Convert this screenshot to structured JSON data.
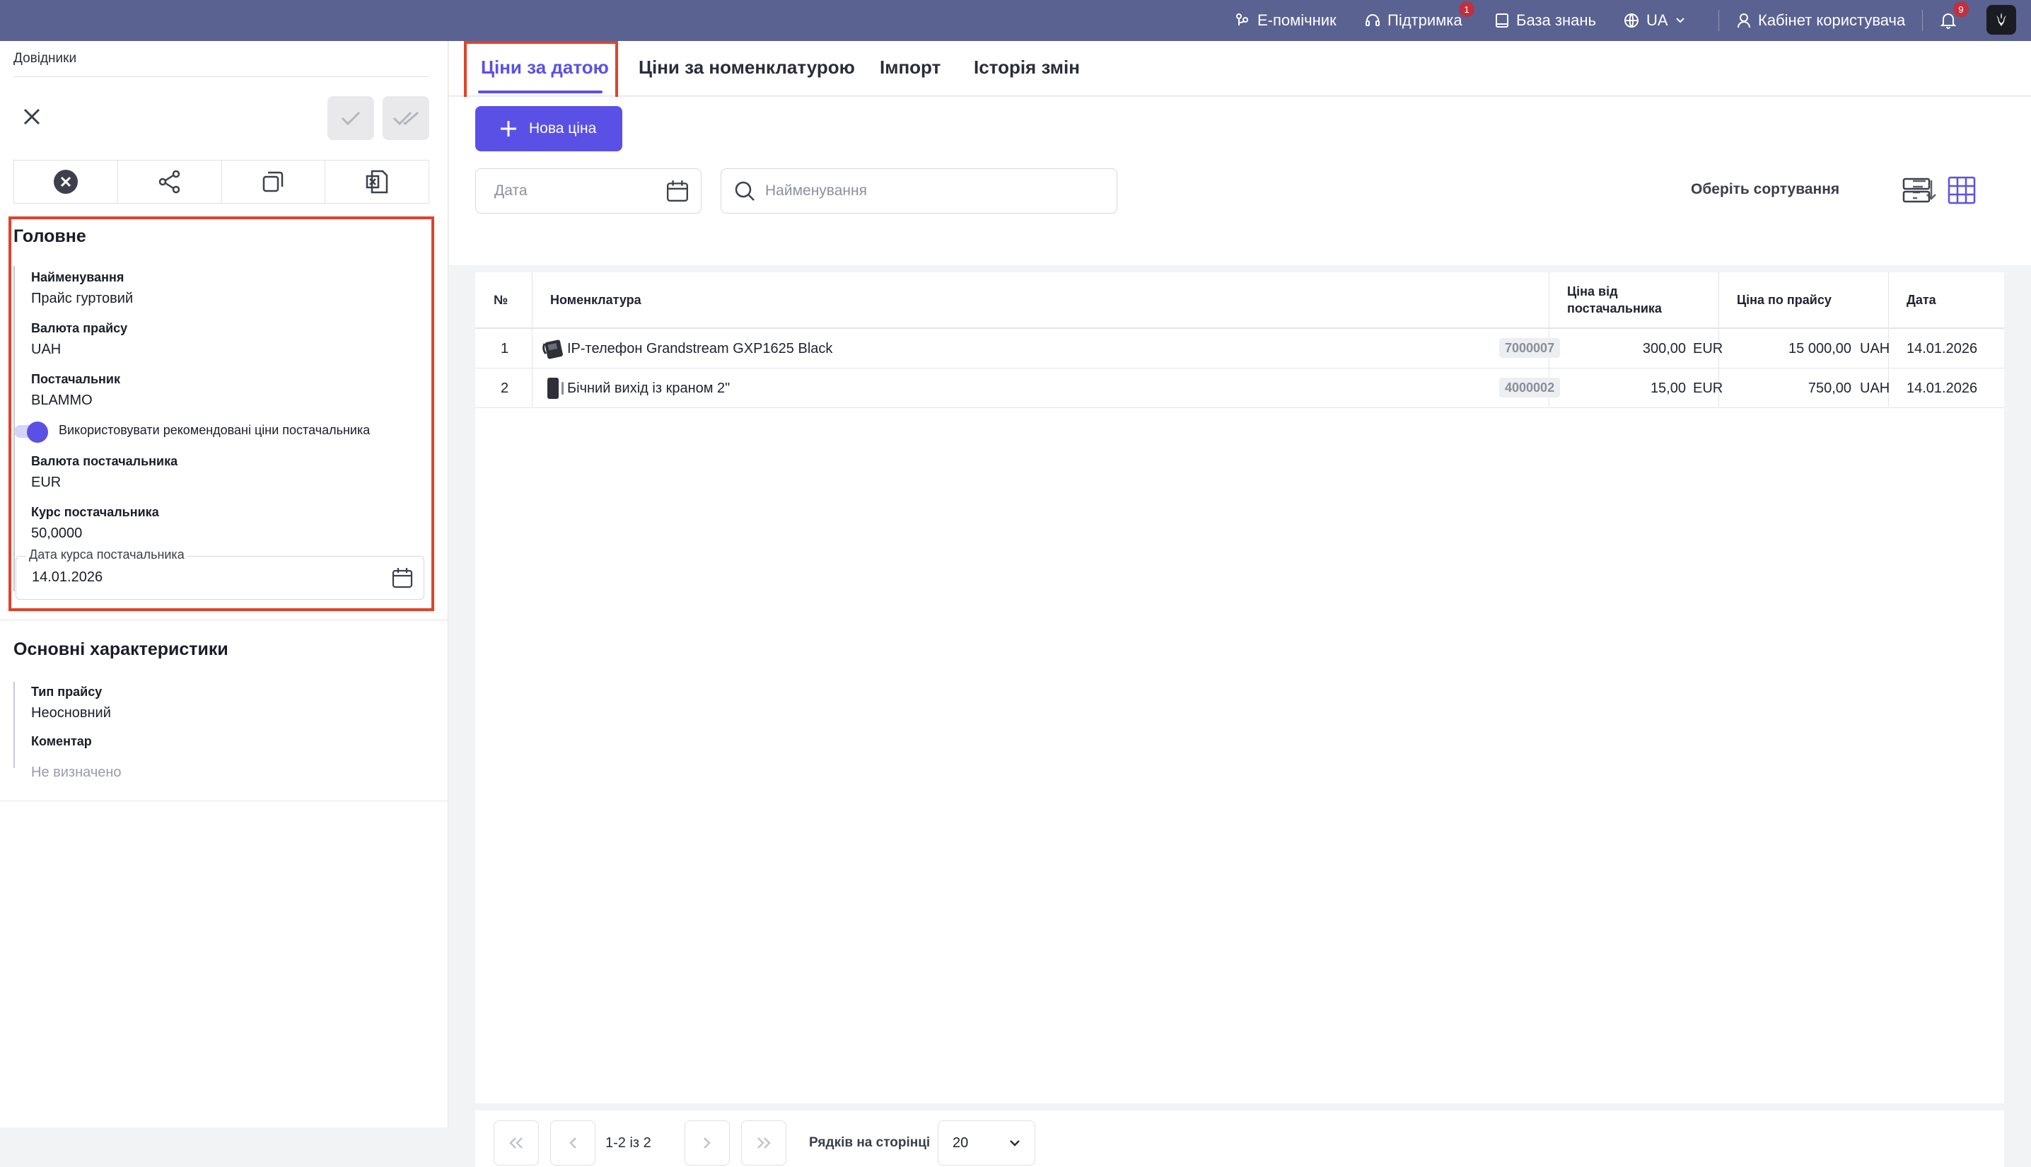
{
  "topbar": {
    "assistant": "Е-помічник",
    "support": "Підтримка",
    "support_badge": "1",
    "knowledge": "База знань",
    "language": "UA",
    "cabinet": "Кабінет користувача",
    "notifications_badge": "9"
  },
  "sidebar": {
    "breadcrumb": "Довідники",
    "main_section": {
      "title": "Головне",
      "name_label": "Найменування",
      "name_value": "Прайс гуртовий",
      "price_currency_label": "Валюта прайсу",
      "price_currency_value": "UAH",
      "supplier_label": "Постачальник",
      "supplier_value": "BLAMMO",
      "use_recommended_label": "Використовувати рекомендовані ціни постачальника",
      "supplier_currency_label": "Валюта постачальника",
      "supplier_currency_value": "EUR",
      "supplier_rate_label": "Курс постачальника",
      "supplier_rate_value": "50,0000",
      "rate_date_label": "Дата курса постачальника",
      "rate_date_value": "14.01.2026"
    },
    "characteristics": {
      "title": "Основні характеристики",
      "type_label": "Тип прайсу",
      "type_value": "Неосновний",
      "comment_label": "Коментар",
      "comment_value": "Не визначено"
    }
  },
  "tabs": [
    "Ціни за датою",
    "Ціни за номенклатурою",
    "Імпорт",
    "Історія змін"
  ],
  "toolbar": {
    "new_price": "Нова ціна",
    "date_placeholder": "Дата",
    "name_placeholder": "Найменування",
    "sort_label": "Оберіть сортування"
  },
  "table": {
    "headers": {
      "num": "№",
      "item": "Номенклатура",
      "supplier_price_line1": "Ціна від",
      "supplier_price_line2": "постачальника",
      "list_price": "Ціна по прайсу",
      "date": "Дата"
    },
    "rows": [
      {
        "num": "1",
        "name": "IP-телефон Grandstream GXP1625 Black",
        "code": "7000007",
        "supplier_price": "300,00",
        "supplier_currency": "EUR",
        "list_price": "15 000,00",
        "list_currency": "UAH",
        "date": "14.01.2026"
      },
      {
        "num": "2",
        "name": "Бічний вихід із краном 2\"",
        "code": "4000002",
        "supplier_price": "15,00",
        "supplier_currency": "EUR",
        "list_price": "750,00",
        "list_currency": "UAH",
        "date": "14.01.2026"
      }
    ]
  },
  "pager": {
    "range": "1-2 із 2",
    "rows_per_page_label": "Рядків на сторінці",
    "rows_per_page_value": "20"
  },
  "colors": {
    "topbar": "#5a6291",
    "accent": "#5b50e6",
    "highlight_box": "#e0432b"
  }
}
